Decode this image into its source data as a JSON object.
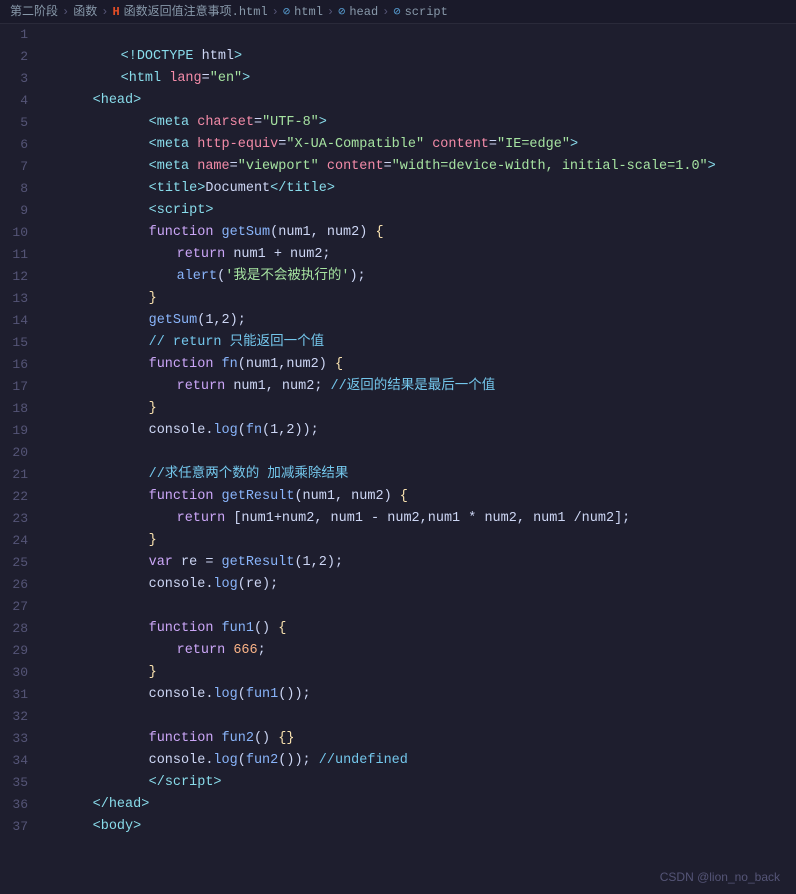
{
  "breadcrumb": {
    "items": [
      {
        "label": "第二阶段",
        "type": "text"
      },
      {
        "label": ">",
        "type": "sep"
      },
      {
        "label": "函数",
        "type": "text"
      },
      {
        "label": ">",
        "type": "sep"
      },
      {
        "label": "H",
        "type": "html-icon"
      },
      {
        "label": "函数返回值注意事项.html",
        "type": "text"
      },
      {
        "label": ">",
        "type": "sep"
      },
      {
        "label": "html",
        "type": "tag"
      },
      {
        "label": ">",
        "type": "sep"
      },
      {
        "label": "head",
        "type": "tag"
      },
      {
        "label": ">",
        "type": "sep"
      },
      {
        "label": "script",
        "type": "tag"
      }
    ]
  },
  "watermark": "CSDN @lion_no_back",
  "lines": [
    {
      "num": 1
    },
    {
      "num": 2
    },
    {
      "num": 3
    },
    {
      "num": 4
    },
    {
      "num": 5
    },
    {
      "num": 6
    },
    {
      "num": 7
    },
    {
      "num": 8
    },
    {
      "num": 9
    },
    {
      "num": 10
    },
    {
      "num": 11
    },
    {
      "num": 12
    },
    {
      "num": 13
    },
    {
      "num": 14
    },
    {
      "num": 15
    },
    {
      "num": 16
    },
    {
      "num": 17
    },
    {
      "num": 18
    },
    {
      "num": 19
    },
    {
      "num": 20
    },
    {
      "num": 21
    },
    {
      "num": 22
    },
    {
      "num": 23
    },
    {
      "num": 24
    },
    {
      "num": 25
    },
    {
      "num": 26
    },
    {
      "num": 27
    },
    {
      "num": 28
    },
    {
      "num": 29
    },
    {
      "num": 30
    },
    {
      "num": 31
    },
    {
      "num": 32
    },
    {
      "num": 33
    },
    {
      "num": 34
    },
    {
      "num": 35
    },
    {
      "num": 36
    },
    {
      "num": 37
    }
  ]
}
